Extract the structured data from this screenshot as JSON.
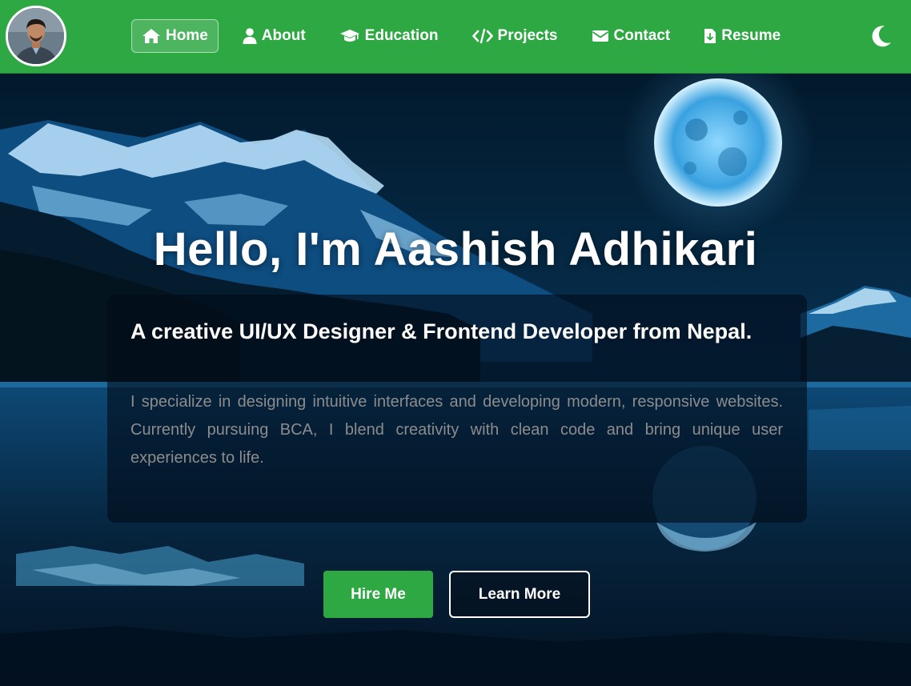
{
  "nav": {
    "items": [
      {
        "label": "Home",
        "icon": "home-icon",
        "active": true
      },
      {
        "label": "About",
        "icon": "user-icon",
        "active": false
      },
      {
        "label": "Education",
        "icon": "graduation-cap-icon",
        "active": false
      },
      {
        "label": "Projects",
        "icon": "code-icon",
        "active": false
      },
      {
        "label": "Contact",
        "icon": "envelope-icon",
        "active": false
      },
      {
        "label": "Resume",
        "icon": "file-download-icon",
        "active": false
      }
    ],
    "theme_toggle_icon": "moon-icon"
  },
  "hero": {
    "title": "Hello, I'm Aashish Adhikari",
    "subtitle": "A creative UI/UX Designer & Frontend Developer from Nepal.",
    "description": "I specialize in designing intuitive interfaces and developing modern, responsive websites. Currently pursuing BCA, I blend creativity with clean code and bring unique user experiences to life.",
    "primary_button": "Hire Me",
    "secondary_button": "Learn More"
  },
  "colors": {
    "brand_green": "#2ea843",
    "text_white": "#ffffff",
    "muted_text": "#8c8c8c",
    "sky_dark": "#0a1e33"
  }
}
